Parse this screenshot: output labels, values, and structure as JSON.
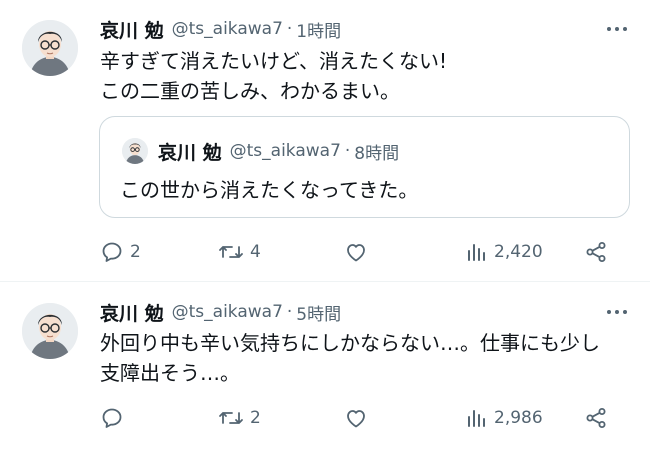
{
  "tweets": [
    {
      "name": "哀川 勉",
      "handle": "@ts_aikawa7",
      "dot": "·",
      "time": "1時間",
      "lines": [
        "辛すぎて消えたいけど、消えたくない!",
        "この二重の苦しみ、わかるまい。"
      ],
      "quote": {
        "name": "哀川 勉",
        "handle": "@ts_aikawa7",
        "dot": "·",
        "time": "8時間",
        "text": "この世から消えたくなってきた。"
      },
      "actions": {
        "replies": "2",
        "retweets": "4",
        "likes": "",
        "views": "2,420"
      }
    },
    {
      "name": "哀川 勉",
      "handle": "@ts_aikawa7",
      "dot": "·",
      "time": "5時間",
      "lines": [
        "外回り中も辛い気持ちにしかならない…。仕事にも少し",
        "支障出そう…。"
      ],
      "actions": {
        "replies": "",
        "retweets": "2",
        "likes": "",
        "views": "2,986"
      }
    }
  ],
  "icons": {
    "more": "more-icon",
    "reply": "reply-icon",
    "retweet": "retweet-icon",
    "like": "heart-icon",
    "views": "views-icon",
    "share": "share-icon"
  },
  "colors": {
    "text": "#0f1419",
    "secondary": "#536471",
    "border": "#cfd9de",
    "divider": "#eff3f4"
  }
}
